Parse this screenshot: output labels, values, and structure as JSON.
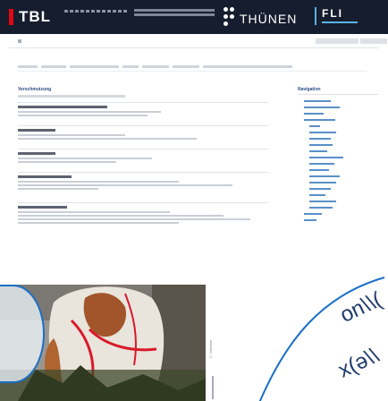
{
  "header": {
    "logo_tbl": "TBL",
    "logo_thuenen": "THÜNEN",
    "logo_fli": "FLI"
  },
  "breadcrumb": {
    "items": [
      "",
      "",
      "",
      "",
      "",
      "",
      "",
      "",
      ""
    ]
  },
  "content": {
    "title": "Verschmutzung"
  },
  "navigation": {
    "title": "Navigation"
  },
  "photo": {
    "credit": "C. Winckler"
  },
  "decor": {
    "text_1": "on\\\\(",
    "text_2": "x(ə\\\\"
  }
}
